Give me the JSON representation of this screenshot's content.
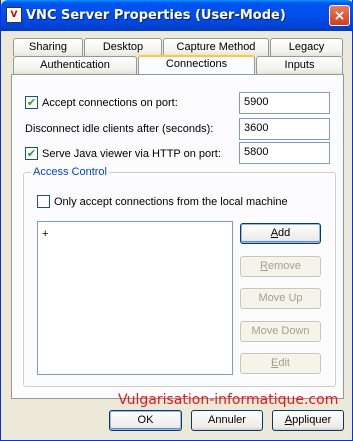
{
  "window": {
    "title": "VNC Server Properties (User-Mode)",
    "close_glyph": "×",
    "app_icon_glyph": "V"
  },
  "tabs_back": [
    {
      "label": "Sharing"
    },
    {
      "label": "Desktop"
    },
    {
      "label": "Capture Method"
    },
    {
      "label": "Legacy"
    }
  ],
  "tabs_front": [
    {
      "label": "Authentication"
    },
    {
      "label": "Connections",
      "active": true
    },
    {
      "label": "Inputs"
    }
  ],
  "connections": {
    "accept_label": "Accept connections on port:",
    "accept_checked": true,
    "accept_port": "5900",
    "idle_label": "Disconnect idle clients after (seconds):",
    "idle_value": "3600",
    "java_label": "Serve Java viewer via HTTP on port:",
    "java_checked": true,
    "java_port": "5800",
    "check_glyph": "✔"
  },
  "access_control": {
    "group_label": "Access Control",
    "local_only_label": "Only accept connections from the local machine",
    "local_only_checked": false,
    "list_items": [
      "+"
    ],
    "buttons": {
      "add": {
        "prefix": "",
        "underline": "A",
        "suffix": "dd"
      },
      "remove": {
        "prefix": "",
        "underline": "R",
        "suffix": "emove"
      },
      "move_up": "Move Up",
      "move_down": "Move Down",
      "edit": {
        "prefix": "",
        "underline": "E",
        "suffix": "dit"
      }
    }
  },
  "footer": {
    "ok": "OK",
    "cancel": "Annuler",
    "apply": {
      "prefix": "",
      "underline": "A",
      "suffix": "ppliquer"
    }
  },
  "watermark": "Vulgarisation-informatique.com"
}
